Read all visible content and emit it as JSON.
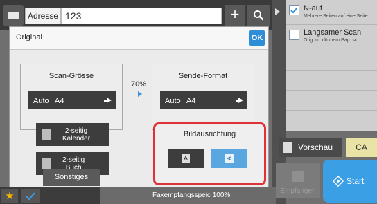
{
  "address_bar": {
    "address_button_label": "Adresse",
    "address_value": "123",
    "plus_label": "+"
  },
  "right_panel": {
    "items": [
      {
        "title": "N-auf",
        "subtitle": "Mehrere Seiten auf eine Seite",
        "checked": true
      },
      {
        "title": "Langsamer Scan",
        "subtitle": "Orig. m. dünnem Pap. sc.",
        "checked": false
      }
    ],
    "preview_label": "Vorschau",
    "ca_label": "CA",
    "receive_label": "Empfangen",
    "start_label": "Start"
  },
  "dialog": {
    "title": "Original",
    "ok_label": "OK",
    "scan_size": {
      "label": "Scan-Grösse",
      "mode": "Auto",
      "size": "A4"
    },
    "ratio": "70%",
    "send_format": {
      "label": "Sende-Format",
      "mode": "Auto",
      "size": "A4"
    },
    "duplex_calendar": {
      "line1": "2-seitig",
      "line2": "Kalender"
    },
    "duplex_book": {
      "line1": "2-seitig",
      "line2": "Buch"
    },
    "orientation": {
      "label": "Bildausrichtung",
      "portrait_glyph": "A",
      "landscape_glyph": "A",
      "selected": "landscape"
    }
  },
  "bottom_bar": {
    "other_label": "Sonstiges",
    "fax_memory_label": "Faxempfangsspeic",
    "fax_memory_value": "100%"
  },
  "colors": {
    "accent_blue": "#2e8fd8",
    "start_blue": "#3b9fe6",
    "highlight_red": "#e03139",
    "ca_yellow": "#e9e4a6",
    "star_yellow": "#f4b400"
  }
}
